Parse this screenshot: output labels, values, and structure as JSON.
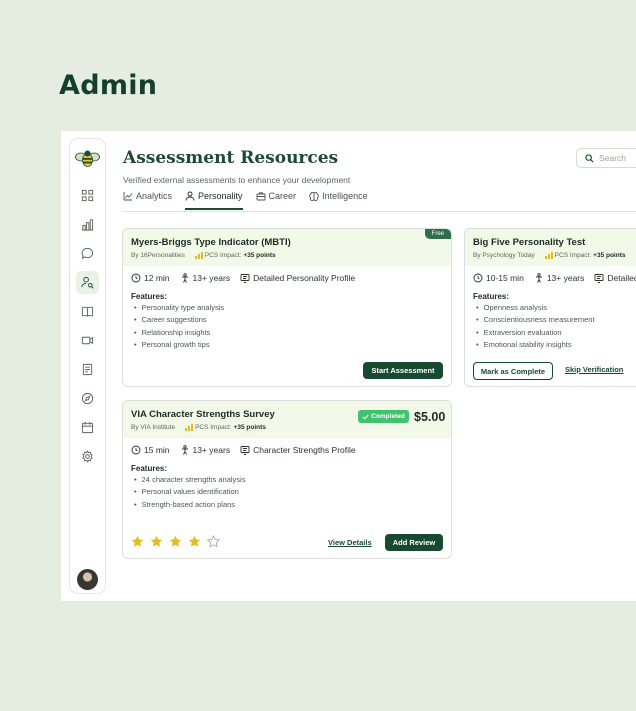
{
  "page_label": "Admin",
  "header": {
    "title": "Assessment Resources",
    "subtitle": "Verified external assessments to enhance your development",
    "search_placeholder": "Search"
  },
  "tabs": [
    {
      "label": "Analytics",
      "icon": "chart-icon",
      "active": false
    },
    {
      "label": "Personality",
      "icon": "user-icon",
      "active": true
    },
    {
      "label": "Career",
      "icon": "briefcase-icon",
      "active": false
    },
    {
      "label": "Intelligence",
      "icon": "brain-icon",
      "active": false
    }
  ],
  "sidebar": {
    "items": [
      "grid-icon",
      "bar-chart-icon",
      "chat-icon",
      "user-search-icon",
      "book-icon",
      "video-icon",
      "document-icon",
      "compass-icon",
      "calendar-icon",
      "settings-icon"
    ],
    "active": "user-search-icon"
  },
  "cards": {
    "mbti": {
      "badge": "Free",
      "name": "Myers-Briggs Type Indicator (MBTI)",
      "by": "By 16Personalities",
      "pcs_label": "PCS Impact:",
      "pcs_value": "+35 points",
      "duration": "12 min",
      "age": "13+ years",
      "profile": "Detailed Personality Profile",
      "features_title": "Features:",
      "features": [
        "Personality type analysis",
        "Career suggestions",
        "Relationship insights",
        "Personal growth tips"
      ],
      "button": "Start Assessment"
    },
    "big_five": {
      "name": "Big Five Personality Test",
      "by": "By Psychology Today",
      "pcs_label": "PCS Impact:",
      "pcs_value": "+35 points",
      "duration": "10-15 min",
      "age": "13+ years",
      "profile": "Detailed Pe",
      "features_title": "Features:",
      "features": [
        "Openness analysis",
        "Conscientiousness measurement",
        "Extraversion evaluation",
        "Emotional stability insights"
      ],
      "button": "Mark as Complete",
      "link": "Skip Verification"
    },
    "via": {
      "name": "VIA Character Strengths Survey",
      "by": "By VIA Institute",
      "pcs_label": "PCS Impact:",
      "pcs_value": "+35 points",
      "status": "Completed",
      "price": "$5.00",
      "duration": "15 min",
      "age": "13+ years",
      "profile": "Character Strengths Profile",
      "features_title": "Features:",
      "features": [
        "24 character strengths analysis",
        "Personal values identification",
        "Strength-based action plans"
      ],
      "rating": 4,
      "rating_max": 5,
      "link": "View Details",
      "button": "Add Review"
    }
  },
  "colors": {
    "brand": "#174a31",
    "accent_green": "#3ec46d",
    "star": "#e8b923",
    "card_header": "#f2f9e8",
    "background": "#e4eddf"
  }
}
